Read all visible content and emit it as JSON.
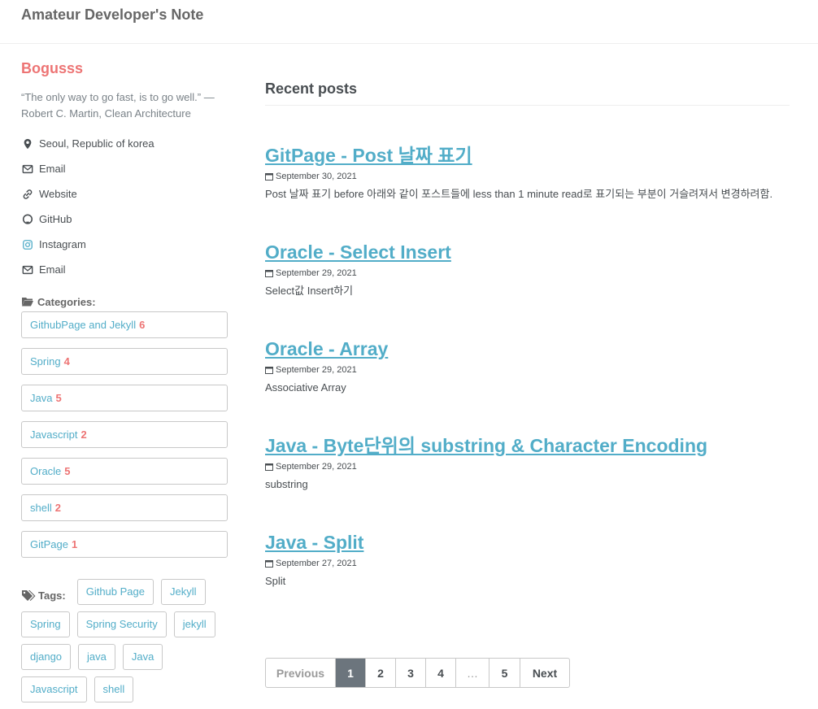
{
  "site": {
    "title": "Amateur Developer's Note"
  },
  "author": {
    "name": "Bogusss",
    "bio": "“The only way to go fast, is to go well.” — Robert C. Martin, Clean Architecture",
    "links": [
      {
        "icon": "map-marker-icon",
        "label": "Seoul, Republic of korea"
      },
      {
        "icon": "envelope-icon",
        "label": "Email"
      },
      {
        "icon": "link-icon",
        "label": "Website"
      },
      {
        "icon": "github-icon",
        "label": "GitHub"
      },
      {
        "icon": "instagram-icon",
        "label": "Instagram"
      },
      {
        "icon": "envelope-icon",
        "label": "Email"
      }
    ]
  },
  "categories": {
    "heading": "Categories:",
    "items": [
      {
        "name": "GithubPage and Jekyll",
        "count": "6"
      },
      {
        "name": "Spring",
        "count": "4"
      },
      {
        "name": "Java",
        "count": "5"
      },
      {
        "name": "Javascript",
        "count": "2"
      },
      {
        "name": "Oracle",
        "count": "5"
      },
      {
        "name": "shell",
        "count": "2"
      },
      {
        "name": "GitPage",
        "count": "1"
      }
    ]
  },
  "tags": {
    "heading": "Tags:",
    "items": [
      "Github Page",
      "Jekyll",
      "Spring",
      "Spring Security",
      "jekyll",
      "django",
      "java",
      "Java",
      "Javascript",
      "shell"
    ]
  },
  "main": {
    "heading": "Recent posts",
    "posts": [
      {
        "title": "GitPage - Post 날짜 표기",
        "date": "September 30, 2021",
        "excerpt": "Post 날짜 표기 before 아래와 같이 포스트들에 less than 1 minute read로 표기되는 부분이 거슬려져서 변경하려함."
      },
      {
        "title": "Oracle - Select Insert",
        "date": "September 29, 2021",
        "excerpt": "Select값 Insert하기"
      },
      {
        "title": "Oracle - Array",
        "date": "September 29, 2021",
        "excerpt": "Associative Array"
      },
      {
        "title": "Java - Byte단위의 substring & Character Encoding",
        "date": "September 29, 2021",
        "excerpt": "substring"
      },
      {
        "title": "Java - Split",
        "date": "September 27, 2021",
        "excerpt": "Split"
      }
    ]
  },
  "pagination": {
    "previous": "Previous",
    "pages": [
      "1",
      "2",
      "3",
      "4",
      "…",
      "5"
    ],
    "current": "1",
    "next": "Next"
  },
  "colors": {
    "accent": "#52adc8",
    "author": "#ed7474",
    "current_page": "#6c757d"
  }
}
